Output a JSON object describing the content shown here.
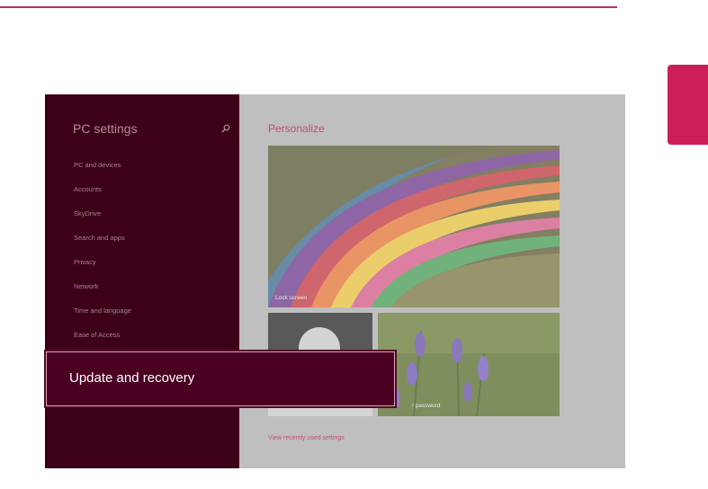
{
  "accent_color": "#cc1e5b",
  "sidebar": {
    "title": "PC settings",
    "search_icon": "search-icon",
    "items": [
      {
        "label": "PC and devices"
      },
      {
        "label": "Accounts"
      },
      {
        "label": "SkyDrive"
      },
      {
        "label": "Search and apps"
      },
      {
        "label": "Privacy"
      },
      {
        "label": "Network"
      },
      {
        "label": "Time and language"
      },
      {
        "label": "Ease of Access"
      }
    ]
  },
  "highlight": {
    "label": "Update and recovery"
  },
  "main": {
    "title": "Personalize",
    "lock_screen_label": "Lock screen",
    "password_label_partial": "word",
    "password_label_tail": "/ password",
    "recent_link": "View recently used settings"
  }
}
